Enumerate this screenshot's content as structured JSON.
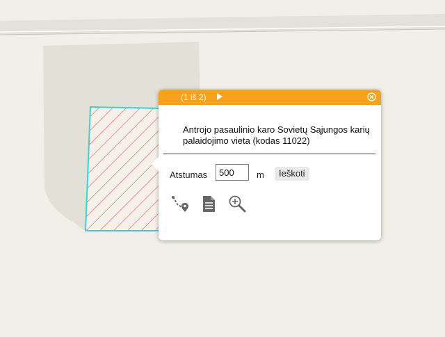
{
  "map": {
    "colors": {
      "background": "#f2efe9",
      "road": "#e3e1dc",
      "area": "#e3e0d7",
      "selected_outline": "#33d6d6",
      "hatch": "#e8595a"
    }
  },
  "popup": {
    "counter": "(1 iš 2)",
    "next_icon": "play-arrow-icon",
    "close_icon": "close-circle-icon",
    "header_color": "#f5a21d",
    "title": "Antrojo pasaulinio karo Sovietų Sąjungos karių palaidojimo vieta (kodas 11022)",
    "distance_label": "Atstumas",
    "distance_value": "500",
    "unit": "m",
    "search_label": "Ieškoti",
    "tools": [
      {
        "icon": "route-directions-icon"
      },
      {
        "icon": "document-icon"
      },
      {
        "icon": "zoom-in-icon"
      }
    ]
  }
}
